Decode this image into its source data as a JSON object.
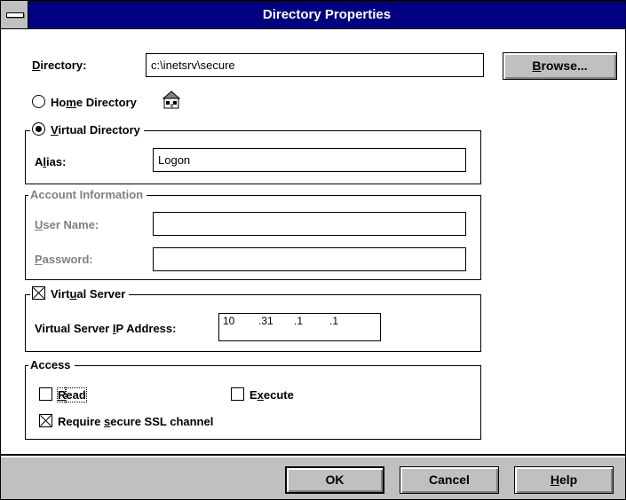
{
  "window": {
    "title": "Directory Properties"
  },
  "directory": {
    "label": "Directory:",
    "value": "c:\\inetsrv\\secure",
    "browse_label": "Browse..."
  },
  "home_directory": {
    "label": "Home Directory",
    "selected": false
  },
  "virtual_directory": {
    "label": "Virtual Directory",
    "selected": true,
    "alias_label": "Alias:",
    "alias_value": "Logon"
  },
  "account": {
    "label": "Account Information",
    "user_label": "User Name:",
    "user_value": "",
    "password_label": "Password:",
    "password_value": ""
  },
  "virtual_server": {
    "label": "Virtual Server",
    "checked": true,
    "ip_label": "Virtual Server IP Address:",
    "ip": [
      "10",
      ".31",
      ".1",
      ".1"
    ]
  },
  "access": {
    "label": "Access",
    "read_label": "Read",
    "read_checked": false,
    "execute_label": "Execute",
    "execute_checked": false,
    "ssl_label": "Require secure SSL channel",
    "ssl_checked": true
  },
  "buttons": {
    "ok": "OK",
    "cancel": "Cancel",
    "help": "Help"
  },
  "icons": {
    "sysmenu": "system-menu-icon",
    "home": "home-directory-icon"
  }
}
